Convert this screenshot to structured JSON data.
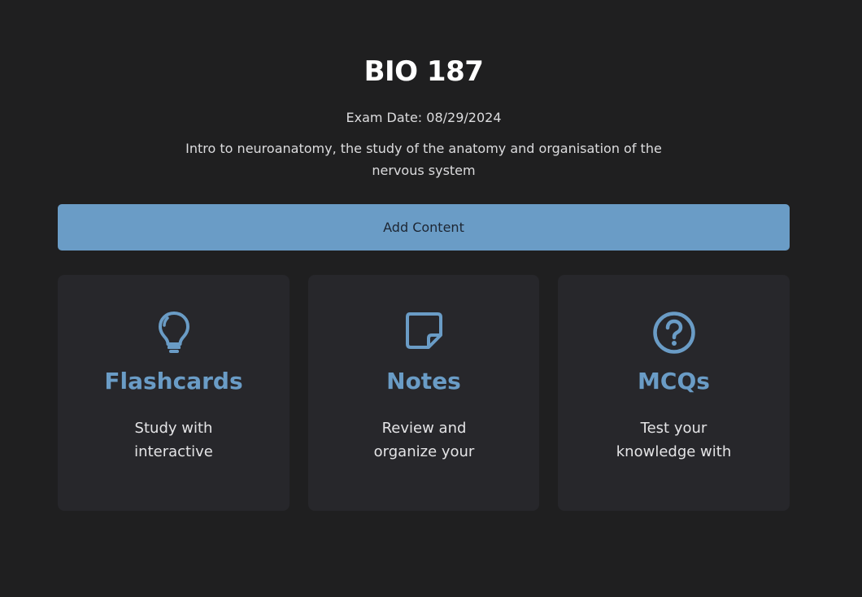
{
  "course": {
    "title": "BIO 187",
    "exam_date": "Exam Date: 08/29/2024",
    "description": "Intro to neuroanatomy, the study of the anatomy and organisation of the nervous system"
  },
  "actions": {
    "add_content_label": "Add Content"
  },
  "cards": [
    {
      "title": "Flashcards",
      "description_line1": "Study with",
      "description_line2": "interactive",
      "icon": "lightbulb-icon"
    },
    {
      "title": "Notes",
      "description_line1": "Review and",
      "description_line2": "organize your",
      "icon": "note-icon"
    },
    {
      "title": "MCQs",
      "description_line1": "Test your",
      "description_line2": "knowledge with",
      "icon": "question-circle-icon"
    }
  ],
  "colors": {
    "background": "#1f1f20",
    "card_background": "#27272b",
    "accent": "#6a9cc6",
    "button_text": "#1d2633",
    "title": "#ffffff"
  }
}
